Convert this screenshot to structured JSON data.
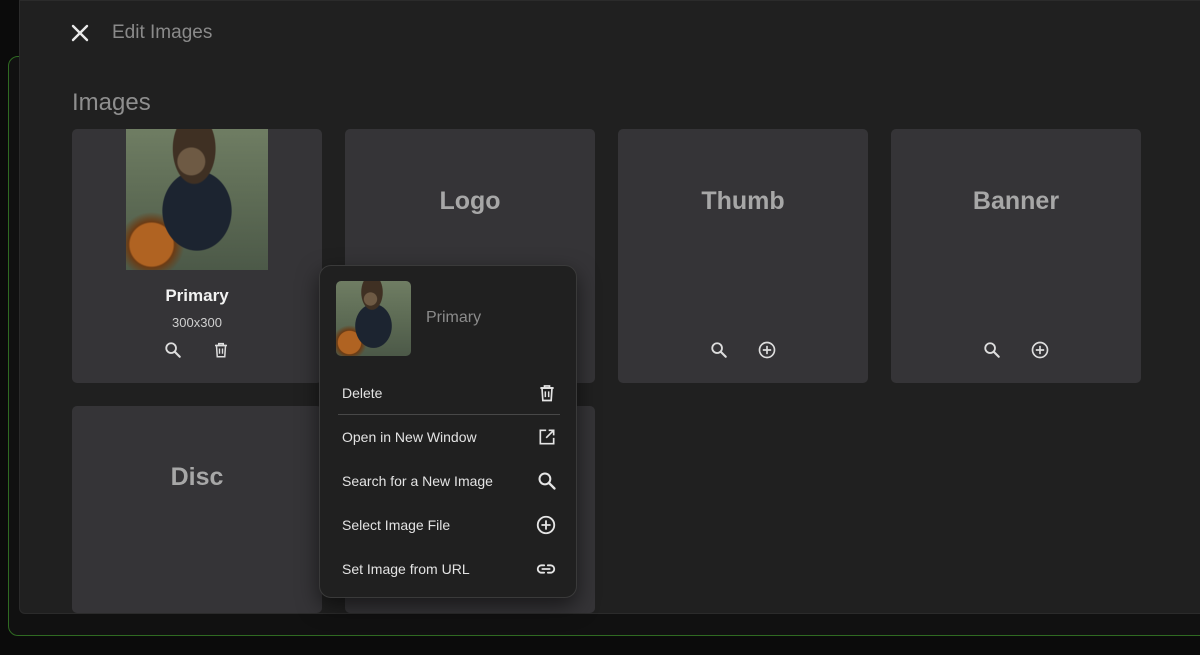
{
  "dialog": {
    "title": "Edit Images",
    "close_icon": "close-icon"
  },
  "section": {
    "title": "Images"
  },
  "cards": {
    "primary": {
      "label": "Primary",
      "size": "300x300"
    },
    "logo": {
      "label": "Logo"
    },
    "thumb": {
      "label": "Thumb"
    },
    "banner": {
      "label": "Banner"
    },
    "disc": {
      "label": "Disc"
    }
  },
  "menu": {
    "header": {
      "label": "Primary"
    },
    "items": [
      {
        "label": "Delete",
        "icon": "trash-icon"
      },
      {
        "label": "Open in New Window",
        "icon": "open-in-new-icon"
      },
      {
        "label": "Search for a New Image",
        "icon": "search-icon"
      },
      {
        "label": "Select Image File",
        "icon": "add-circle-icon"
      },
      {
        "label": "Set Image from URL",
        "icon": "link-icon"
      }
    ]
  },
  "colors": {
    "card_background": "#353437",
    "dialog_background": "#202020",
    "accent_border": "#2f6a22"
  }
}
